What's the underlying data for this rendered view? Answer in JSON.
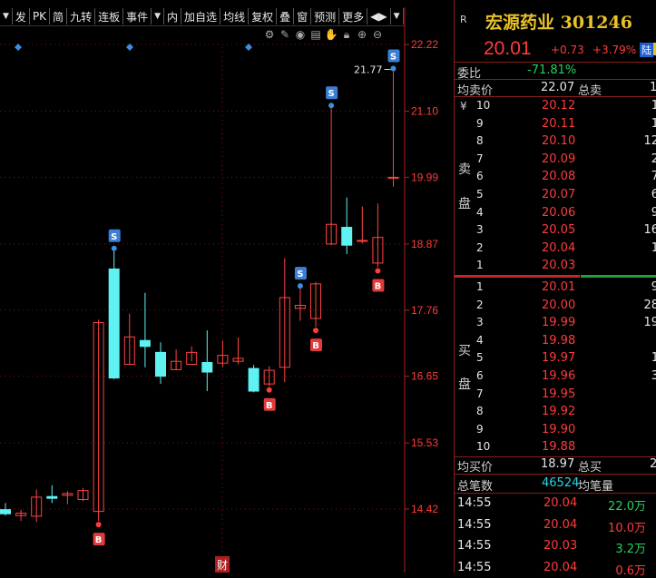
{
  "toolbar": {
    "items": [
      "▼",
      "发",
      "PK",
      "简",
      "九转",
      "连板",
      "事件",
      "▼",
      "内",
      "加自选",
      "均线",
      "复权",
      "叠",
      "窗",
      "预测",
      "更多",
      "◀▶",
      "▼"
    ]
  },
  "chart_tools": [
    "gear-icon",
    "pen-icon",
    "eye-icon",
    "layers-icon",
    "hand-icon",
    "lock-icon",
    "zoom-in-icon",
    "zoom-out-icon"
  ],
  "price_axis": {
    "labels": [
      "22.22",
      "21.10",
      "19.99",
      "18.87",
      "17.76",
      "16.65",
      "15.53",
      "14.42"
    ],
    "high_label": "21.77",
    "markers": {
      "sell": "S",
      "buy": "B",
      "finance": "财"
    }
  },
  "chart_data": {
    "type": "candlestick",
    "ylim": [
      13.9,
      22.7
    ],
    "ticks": [
      22.22,
      21.1,
      19.99,
      18.87,
      17.76,
      16.65,
      15.53,
      14.42
    ],
    "candles": [
      {
        "o": 14.41,
        "h": 14.52,
        "l": 14.31,
        "c": 14.34
      },
      {
        "o": 14.31,
        "h": 14.41,
        "l": 14.22,
        "c": 14.35
      },
      {
        "o": 14.3,
        "h": 14.75,
        "l": 14.2,
        "c": 14.62
      },
      {
        "o": 14.63,
        "h": 14.82,
        "l": 14.52,
        "c": 14.6
      },
      {
        "o": 14.65,
        "h": 14.72,
        "l": 14.5,
        "c": 14.68
      },
      {
        "o": 14.58,
        "h": 14.77,
        "l": 14.55,
        "c": 14.73
      },
      {
        "o": 14.38,
        "h": 17.6,
        "l": 14.22,
        "c": 17.55
      },
      {
        "o": 18.45,
        "h": 18.75,
        "l": 16.6,
        "c": 16.62
      },
      {
        "o": 16.85,
        "h": 17.7,
        "l": 16.85,
        "c": 17.31
      },
      {
        "o": 17.25,
        "h": 18.05,
        "l": 16.8,
        "c": 17.15
      },
      {
        "o": 17.05,
        "h": 17.22,
        "l": 16.52,
        "c": 16.65
      },
      {
        "o": 16.76,
        "h": 17.1,
        "l": 16.75,
        "c": 16.9
      },
      {
        "o": 16.85,
        "h": 17.15,
        "l": 16.9,
        "c": 17.05
      },
      {
        "o": 16.88,
        "h": 17.42,
        "l": 16.4,
        "c": 16.72
      },
      {
        "o": 16.87,
        "h": 17.25,
        "l": 16.8,
        "c": 17.0
      },
      {
        "o": 16.9,
        "h": 17.3,
        "l": 16.85,
        "c": 16.95
      },
      {
        "o": 16.78,
        "h": 16.84,
        "l": 16.38,
        "c": 16.4
      },
      {
        "o": 16.52,
        "h": 16.82,
        "l": 16.48,
        "c": 16.75
      },
      {
        "o": 16.8,
        "h": 18.63,
        "l": 16.55,
        "c": 17.97
      },
      {
        "o": 17.79,
        "h": 18.12,
        "l": 17.58,
        "c": 17.84
      },
      {
        "o": 17.62,
        "h": 18.23,
        "l": 17.48,
        "c": 18.2
      },
      {
        "o": 18.87,
        "h": 21.15,
        "l": 18.85,
        "c": 19.2
      },
      {
        "o": 19.15,
        "h": 19.65,
        "l": 18.7,
        "c": 18.85
      },
      {
        "o": 18.92,
        "h": 19.5,
        "l": 18.88,
        "c": 18.93
      },
      {
        "o": 18.55,
        "h": 19.55,
        "l": 18.48,
        "c": 18.98
      },
      {
        "o": 19.99,
        "h": 21.77,
        "l": 19.83,
        "c": 19.99
      }
    ],
    "sell_markers_at": [
      7,
      19,
      21,
      25
    ],
    "buy_markers_at": [
      6,
      17,
      20,
      24
    ]
  },
  "stock": {
    "name": "宏源药业",
    "code": "301246",
    "price": "20.01",
    "change": "+0.73",
    "pct": "+3.79%",
    "tag": "陆"
  },
  "order_book": {
    "ratio_label": "委比",
    "ratio": "-71.81%",
    "ask_avg_label": "均卖价",
    "ask_avg": "22.07",
    "ask_total_label": "总卖",
    "ask_total": "1",
    "currency": "¥",
    "sell_side": "卖",
    "bid_side": "买",
    "pan": "盘",
    "asks": [
      {
        "lvl": "10",
        "price": "20.12",
        "vol": "1"
      },
      {
        "lvl": "9",
        "price": "20.11",
        "vol": "1"
      },
      {
        "lvl": "8",
        "price": "20.10",
        "vol": "12"
      },
      {
        "lvl": "7",
        "price": "20.09",
        "vol": "2"
      },
      {
        "lvl": "6",
        "price": "20.08",
        "vol": "7"
      },
      {
        "lvl": "5",
        "price": "20.07",
        "vol": "6"
      },
      {
        "lvl": "4",
        "price": "20.06",
        "vol": "9"
      },
      {
        "lvl": "3",
        "price": "20.05",
        "vol": "16"
      },
      {
        "lvl": "2",
        "price": "20.04",
        "vol": "1"
      },
      {
        "lvl": "1",
        "price": "20.03",
        "vol": ""
      }
    ],
    "bids": [
      {
        "lvl": "1",
        "price": "20.01",
        "vol": "9"
      },
      {
        "lvl": "2",
        "price": "20.00",
        "vol": "28"
      },
      {
        "lvl": "3",
        "price": "19.99",
        "vol": "19"
      },
      {
        "lvl": "4",
        "price": "19.98",
        "vol": ""
      },
      {
        "lvl": "5",
        "price": "19.97",
        "vol": "1"
      },
      {
        "lvl": "6",
        "price": "19.96",
        "vol": "3"
      },
      {
        "lvl": "7",
        "price": "19.95",
        "vol": ""
      },
      {
        "lvl": "8",
        "price": "19.92",
        "vol": ""
      },
      {
        "lvl": "9",
        "price": "19.90",
        "vol": ""
      },
      {
        "lvl": "10",
        "price": "19.88",
        "vol": ""
      }
    ],
    "bid_avg_label": "均买价",
    "bid_avg": "18.97",
    "bid_total_label": "总买",
    "bid_total": "2",
    "trades_label": "总笔数",
    "trades": "46524",
    "avg_vol_label": "均笔量"
  },
  "ticks": [
    {
      "time": "14:55",
      "price": "20.04",
      "vol": "22.0万",
      "color": "green"
    },
    {
      "time": "14:55",
      "price": "20.04",
      "vol": "10.0万",
      "color": "red"
    },
    {
      "time": "14:55",
      "price": "20.03",
      "vol": "3.2万",
      "color": "green"
    },
    {
      "time": "14:55",
      "price": "20.04",
      "vol": "0.6万",
      "color": "red"
    }
  ]
}
